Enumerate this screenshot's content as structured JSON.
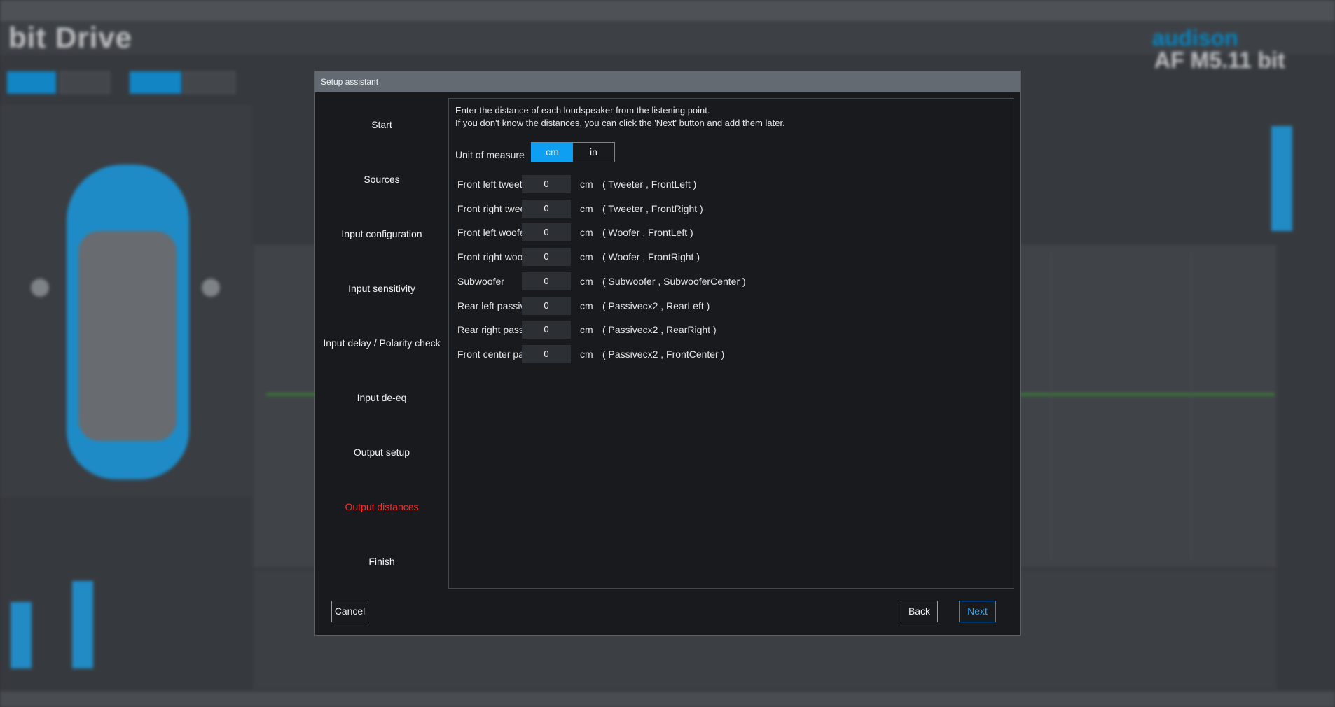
{
  "app": {
    "logo": "bit Drive",
    "brand": "audison",
    "model": "AF M5.11 bit"
  },
  "dialog": {
    "title": "Setup assistant",
    "steps": [
      {
        "label": "Start",
        "active": false
      },
      {
        "label": "Sources",
        "active": false
      },
      {
        "label": "Input configuration",
        "active": false
      },
      {
        "label": "Input sensitivity",
        "active": false
      },
      {
        "label": "Input delay / Polarity check",
        "active": false
      },
      {
        "label": "Input de-eq",
        "active": false
      },
      {
        "label": "Output setup",
        "active": false
      },
      {
        "label": "Output distances",
        "active": true
      },
      {
        "label": "Finish",
        "active": false
      }
    ],
    "instructions": {
      "line1": "Enter the distance of each loudspeaker from the listening point.",
      "line2": "If you don't know the distances, you can click the 'Next' button and add them later."
    },
    "unit_of_measure": {
      "label": "Unit of measure",
      "options": [
        "cm",
        "in"
      ],
      "selected": "cm"
    },
    "outputs": [
      {
        "name": "Front left tweet",
        "value": "0",
        "unit": "cm",
        "desc": "( Tweeter , FrontLeft )"
      },
      {
        "name": "Front right twee",
        "value": "0",
        "unit": "cm",
        "desc": "( Tweeter , FrontRight )"
      },
      {
        "name": "Front left woofe",
        "value": "0",
        "unit": "cm",
        "desc": "( Woofer , FrontLeft )"
      },
      {
        "name": "Front right woof",
        "value": "0",
        "unit": "cm",
        "desc": "( Woofer , FrontRight )"
      },
      {
        "name": "Subwoofer",
        "value": "0",
        "unit": "cm",
        "desc": "( Subwoofer , SubwooferCenter )"
      },
      {
        "name": "Rear left passiv",
        "value": "0",
        "unit": "cm",
        "desc": "( Passivecx2 , RearLeft )"
      },
      {
        "name": "Rear right passi",
        "value": "0",
        "unit": "cm",
        "desc": "( Passivecx2 , RearRight )"
      },
      {
        "name": "Front center pas",
        "value": "0",
        "unit": "cm",
        "desc": "( Passivecx2 , FrontCenter )"
      }
    ],
    "buttons": {
      "cancel": "Cancel",
      "back": "Back",
      "next": "Next"
    }
  },
  "colors": {
    "accent": "#0e9ff2",
    "active_step": "#ff2a2a",
    "dialog_bg": "#181a1d"
  }
}
